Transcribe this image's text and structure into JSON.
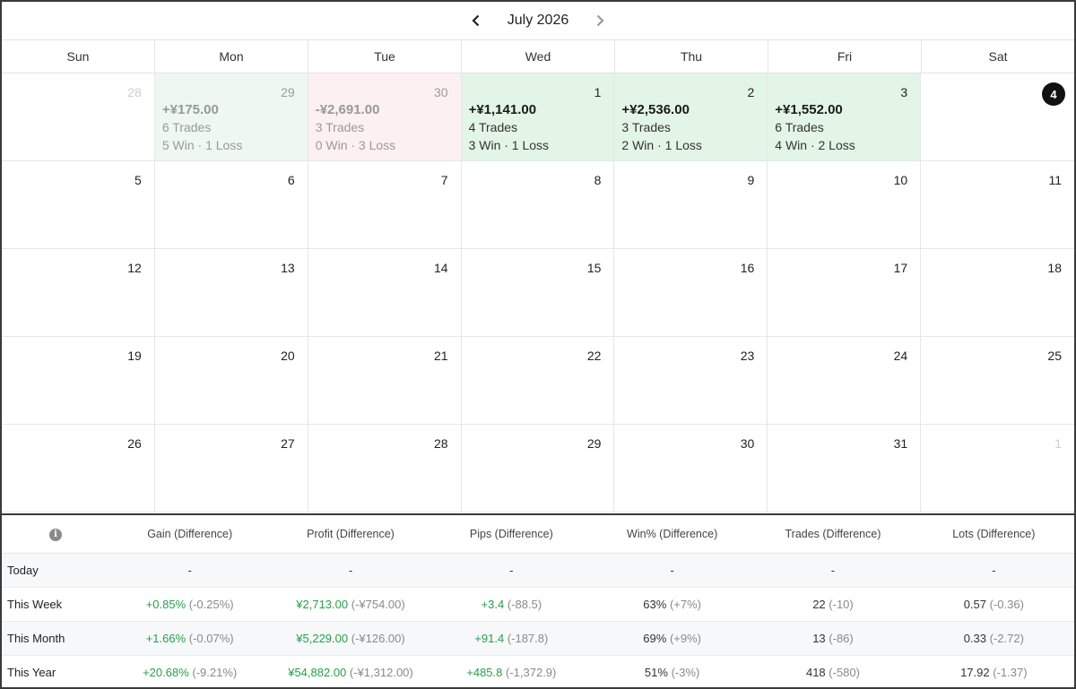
{
  "header": {
    "month": "July 2026"
  },
  "weekdays": [
    "Sun",
    "Mon",
    "Tue",
    "Wed",
    "Thu",
    "Fri",
    "Sat"
  ],
  "weeks": [
    [
      {
        "day": "28",
        "other": true
      },
      {
        "day": "29",
        "pnl": "+¥175.00",
        "trades": "6 Trades",
        "wl": "5 Win · 1 Loss",
        "style": "pos-faded"
      },
      {
        "day": "30",
        "pnl": "-¥2,691.00",
        "trades": "3 Trades",
        "wl": "0 Win · 3 Loss",
        "style": "neg-faded"
      },
      {
        "day": "1",
        "pnl": "+¥1,141.00",
        "trades": "4 Trades",
        "wl": "3 Win · 1 Loss",
        "style": "pos"
      },
      {
        "day": "2",
        "pnl": "+¥2,536.00",
        "trades": "3 Trades",
        "wl": "2 Win · 1 Loss",
        "style": "pos"
      },
      {
        "day": "3",
        "pnl": "+¥1,552.00",
        "trades": "6 Trades",
        "wl": "4 Win · 2 Loss",
        "style": "pos"
      },
      {
        "day": "4",
        "today": true
      }
    ],
    [
      {
        "day": "5"
      },
      {
        "day": "6"
      },
      {
        "day": "7"
      },
      {
        "day": "8"
      },
      {
        "day": "9"
      },
      {
        "day": "10"
      },
      {
        "day": "11"
      }
    ],
    [
      {
        "day": "12"
      },
      {
        "day": "13"
      },
      {
        "day": "14"
      },
      {
        "day": "15"
      },
      {
        "day": "16"
      },
      {
        "day": "17"
      },
      {
        "day": "18"
      }
    ],
    [
      {
        "day": "19"
      },
      {
        "day": "20"
      },
      {
        "day": "21"
      },
      {
        "day": "22"
      },
      {
        "day": "23"
      },
      {
        "day": "24"
      },
      {
        "day": "25"
      }
    ],
    [
      {
        "day": "26"
      },
      {
        "day": "27"
      },
      {
        "day": "28"
      },
      {
        "day": "29"
      },
      {
        "day": "30"
      },
      {
        "day": "31"
      },
      {
        "day": "1",
        "other": true
      }
    ]
  ],
  "stats": {
    "columns": [
      "Gain (Difference)",
      "Profit (Difference)",
      "Pips (Difference)",
      "Win% (Difference)",
      "Trades (Difference)",
      "Lots (Difference)"
    ],
    "rows": [
      {
        "label": "Today",
        "cells": [
          {
            "v": "-"
          },
          {
            "v": "-"
          },
          {
            "v": "-"
          },
          {
            "v": "-"
          },
          {
            "v": "-"
          },
          {
            "v": "-"
          }
        ]
      },
      {
        "label": "This Week",
        "cells": [
          {
            "v": "+0.85%",
            "d": "(-0.25%)",
            "green": true
          },
          {
            "v": "¥2,713.00",
            "d": "(-¥754.00)",
            "green": true
          },
          {
            "v": "+3.4",
            "d": "(-88.5)",
            "green": true
          },
          {
            "v": "63%",
            "d": "(+7%)"
          },
          {
            "v": "22",
            "d": "(-10)"
          },
          {
            "v": "0.57",
            "d": "(-0.36)"
          }
        ]
      },
      {
        "label": "This Month",
        "cells": [
          {
            "v": "+1.66%",
            "d": "(-0.07%)",
            "green": true
          },
          {
            "v": "¥5,229.00",
            "d": "(-¥126.00)",
            "green": true
          },
          {
            "v": "+91.4",
            "d": "(-187.8)",
            "green": true
          },
          {
            "v": "69%",
            "d": "(+9%)"
          },
          {
            "v": "13",
            "d": "(-86)"
          },
          {
            "v": "0.33",
            "d": "(-2.72)"
          }
        ]
      },
      {
        "label": "This Year",
        "cells": [
          {
            "v": "+20.68%",
            "d": "(-9.21%)",
            "green": true
          },
          {
            "v": "¥54,882.00",
            "d": "(-¥1,312.00)",
            "green": true
          },
          {
            "v": "+485.8",
            "d": "(-1,372.9)",
            "green": true
          },
          {
            "v": "51%",
            "d": "(-3%)"
          },
          {
            "v": "418",
            "d": "(-580)"
          },
          {
            "v": "17.92",
            "d": "(-1.37)"
          }
        ]
      }
    ]
  },
  "colors": {
    "positive_bg": "#e3f5e7",
    "negative_bg": "#fdf0f2",
    "gain_text": "#26a04a"
  }
}
